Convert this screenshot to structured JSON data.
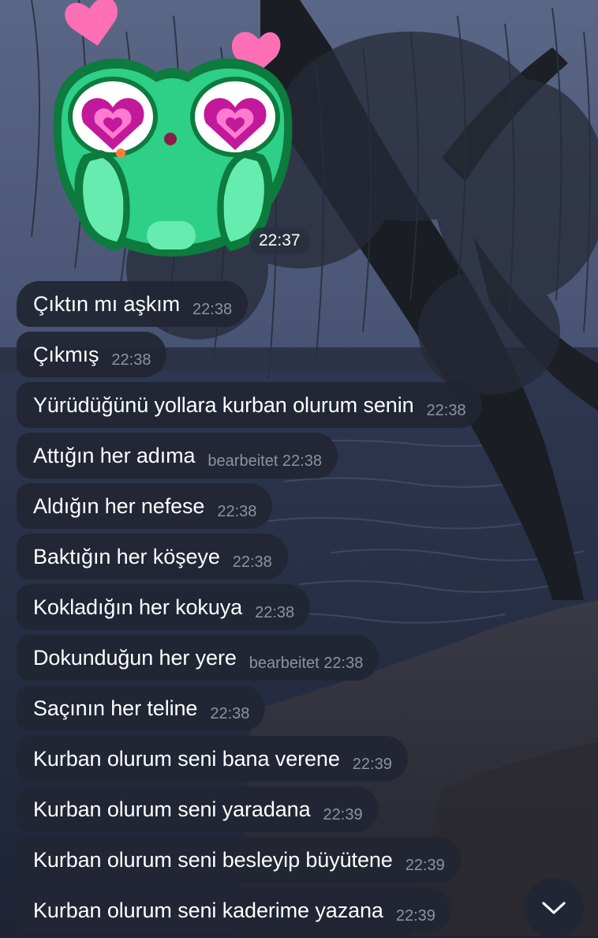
{
  "sticker": {
    "name": "frog-heart-eyes-sticker",
    "time": "22:37",
    "colors": {
      "body": "#2ecf86",
      "outline": "#0d7a3e",
      "heart": "#ff6fb5",
      "eye_heart": "#c2199a"
    }
  },
  "messages": [
    {
      "text": "Çıktın mı aşkım",
      "meta": "22:38"
    },
    {
      "text": "Çıkmış",
      "meta": "22:38"
    },
    {
      "text": "Yürüdüğünü yollara kurban olurum senin",
      "meta": "22:38"
    },
    {
      "text": "Attığın her adıma",
      "meta": "bearbeitet 22:38"
    },
    {
      "text": "Aldığın her nefese",
      "meta": "22:38"
    },
    {
      "text": "Baktığın her köşeye",
      "meta": "22:38"
    },
    {
      "text": "Kokladığın her kokuya",
      "meta": "22:38"
    },
    {
      "text": "Dokunduğun her yere",
      "meta": "bearbeitet 22:38"
    },
    {
      "text": "Saçının her teline",
      "meta": "22:38"
    },
    {
      "text": "Kurban olurum seni bana verene",
      "meta": "22:39"
    },
    {
      "text": "Kurban olurum seni yaradana",
      "meta": "22:39"
    },
    {
      "text": "Kurban olurum seni besleyip büyütene",
      "meta": "22:39"
    },
    {
      "text": "Kurban olurum seni kaderime yazana",
      "meta": "22:39"
    }
  ],
  "scroll_button": {
    "icon": "chevron-down-icon"
  },
  "theme": {
    "bubble_bg": "#212634",
    "text": "#ffffff",
    "meta": "#8b93a3"
  }
}
